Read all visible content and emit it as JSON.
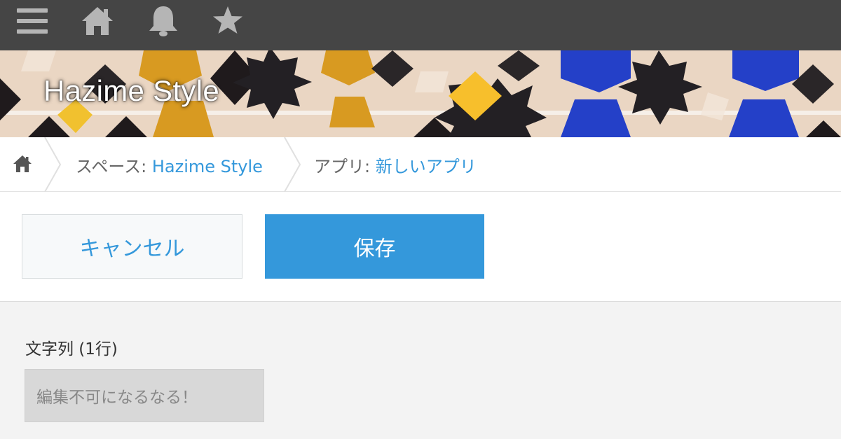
{
  "topbar": {
    "icons": [
      "menu-icon",
      "home-icon",
      "bell-icon",
      "star-icon"
    ],
    "color": "#454545",
    "icon_color": "#b5b5b5"
  },
  "banner": {
    "title": "Hazime Style"
  },
  "breadcrumb": {
    "home_icon": "home-icon",
    "space_prefix": "スペース: ",
    "space_name": "Hazime Style",
    "app_prefix": "アプリ: ",
    "app_name": "新しいアプリ"
  },
  "actions": {
    "cancel_label": "キャンセル",
    "save_label": "保存",
    "accent": "#3498db"
  },
  "form": {
    "field_label": "文字列 (1行)",
    "field_value": "編集不可になるなる！"
  }
}
